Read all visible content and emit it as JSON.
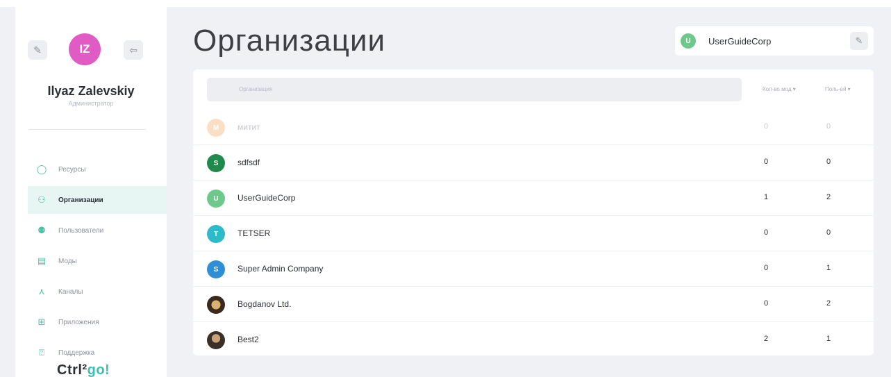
{
  "sidebar": {
    "user_initials": "IZ",
    "user_name": "Ilyaz Zalevskiy",
    "user_role": "Администратор",
    "items": [
      {
        "label": "Ресурсы",
        "icon": "circle-icon"
      },
      {
        "label": "Организации",
        "icon": "org-tree-icon",
        "active": true
      },
      {
        "label": "Пользователи",
        "icon": "users-icon"
      },
      {
        "label": "Моды",
        "icon": "document-icon"
      },
      {
        "label": "Каналы",
        "icon": "channels-icon"
      },
      {
        "label": "Приложения",
        "icon": "apps-grid-icon"
      },
      {
        "label": "Поддержка",
        "icon": "help-icon"
      }
    ],
    "logo_text": "Ctrl²",
    "logo_accent": "go!"
  },
  "header": {
    "title": "Организации",
    "current_org": {
      "initial": "U",
      "name": "UserGuideCorp"
    }
  },
  "table": {
    "columns": {
      "org": "Организация",
      "modes": "Кол-во мод ▾",
      "users": "Поль-ей ▾"
    },
    "rows": [
      {
        "initial": "М",
        "name": "митит",
        "modes": "0",
        "users": "0",
        "color": "#f2a65a",
        "faded": true
      },
      {
        "initial": "S",
        "name": "sdfsdf",
        "modes": "0",
        "users": "0",
        "color": "#1f8a4c"
      },
      {
        "initial": "U",
        "name": "UserGuideCorp",
        "modes": "1",
        "users": "2",
        "color": "#6fc88b"
      },
      {
        "initial": "T",
        "name": "TETSER",
        "modes": "0",
        "users": "0",
        "color": "#2fbac9"
      },
      {
        "initial": "S",
        "name": "Super Admin Company",
        "modes": "0",
        "users": "1",
        "color": "#2f8fd6"
      },
      {
        "initial": "",
        "name": "Bogdanov Ltd.",
        "modes": "0",
        "users": "2",
        "photo": true
      },
      {
        "initial": "",
        "name": "Best2",
        "modes": "2",
        "users": "1",
        "photo": true
      }
    ]
  },
  "colors": {
    "accent": "#39c0b2",
    "avatar": "#e05cc4",
    "active_nav_bg": "#e8f6f3"
  }
}
